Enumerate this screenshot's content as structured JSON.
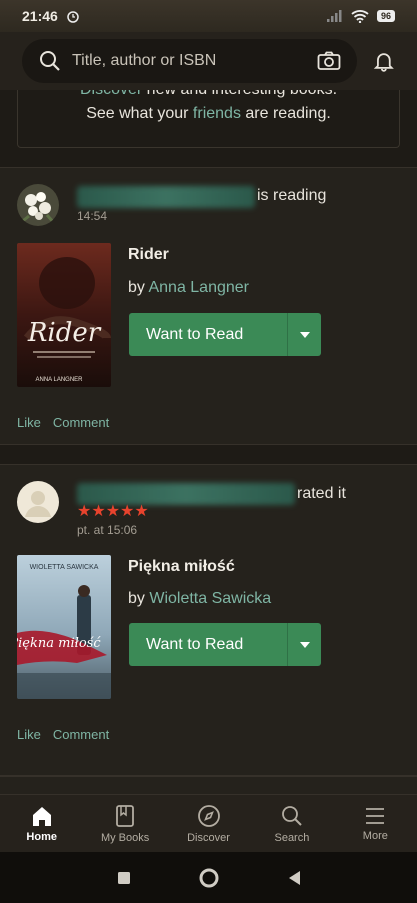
{
  "status_bar": {
    "time": "21:46",
    "battery": "96"
  },
  "search": {
    "placeholder": "Title, author or ISBN"
  },
  "promo": {
    "line1_link": "Discover",
    "line1_rest": " new and interesting books.",
    "line2_pre": "See what your ",
    "line2_link": "friends",
    "line2_post": " are reading."
  },
  "feed": [
    {
      "action": "is reading",
      "timestamp": "14:54",
      "book_title": "Rider",
      "by_label": "by ",
      "author": "Anna Langner",
      "cover_title": "Rider",
      "cover_author": "ANNA LANGNER",
      "button_label": "Want to Read",
      "like_label": "Like",
      "comment_label": "Comment"
    },
    {
      "action": "rated it",
      "rating": 5,
      "stars": "★★★★★",
      "timestamp": "pt. at 15:06",
      "book_title": "Piękna miłość",
      "by_label": "by ",
      "author": "Wioletta Sawicka",
      "cover_title": "Piękna miłość",
      "cover_author": "WIOLETTA SAWICKA",
      "button_label": "Want to Read",
      "like_label": "Like",
      "comment_label": "Comment"
    }
  ],
  "bottom_nav": [
    {
      "label": "Home",
      "icon": "home-icon",
      "active": true
    },
    {
      "label": "My Books",
      "icon": "book-icon"
    },
    {
      "label": "Discover",
      "icon": "compass-icon"
    },
    {
      "label": "Search",
      "icon": "search-icon"
    },
    {
      "label": "More",
      "icon": "menu-icon"
    }
  ],
  "colors": {
    "accent_green": "#3b8a56",
    "link": "#7fb5a4",
    "star": "#e8432d",
    "background": "#1e1b16"
  }
}
